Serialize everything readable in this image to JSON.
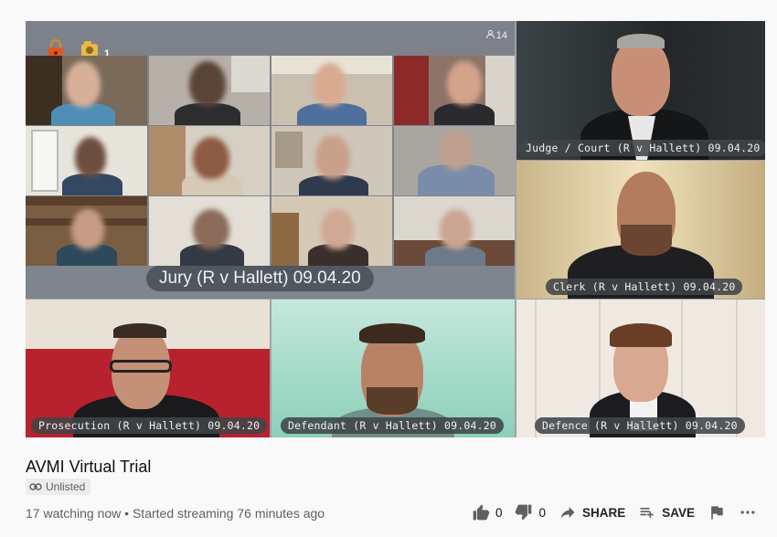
{
  "video": {
    "participant_count": "14",
    "jury_label": "Jury (R v Hallett) 09.04.20",
    "tiles": {
      "judge": "Judge / Court (R v Hallett) 09.04.20",
      "clerk": "Clerk (R v Hallett) 09.04.20",
      "prosecution": "Prosecution (R v Hallett) 09.04.20",
      "defendant": "Defendant (R v Hallett) 09.04.20",
      "defence": "Defence (R v Hallett) 09.04.20"
    },
    "badge_count": "1"
  },
  "info": {
    "title": "AVMI Virtual Trial",
    "privacy": "Unlisted",
    "meta": "17 watching now • Started streaming 76 minutes ago"
  },
  "actions": {
    "likes": "0",
    "dislikes": "0",
    "share": "SHARE",
    "save": "SAVE"
  },
  "icons": [
    "lock-icon",
    "camera-icon",
    "person-icon",
    "link-icon",
    "thumbs-up-icon",
    "thumbs-down-icon",
    "share-icon",
    "playlist-add-icon",
    "flag-icon",
    "more-icon"
  ]
}
